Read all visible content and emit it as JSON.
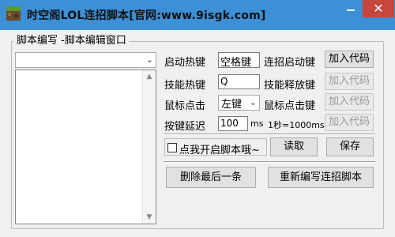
{
  "window": {
    "title": "时空阁LOL连招脚本[官网:www.9isgk.com]",
    "close_icon": "✕"
  },
  "group": {
    "label": "脚本编写 -脚本编辑窗口"
  },
  "combo": {
    "value": "",
    "arrow": "⌄"
  },
  "listbox": {
    "scroll_up": "▲",
    "scroll_down": "▼"
  },
  "row1": {
    "label": "启动热键",
    "hotkey": "空格键",
    "label2": "连招启动键",
    "button": "加入代码"
  },
  "row2": {
    "label": "技能热键",
    "value": "Q",
    "label2": "技能释放键",
    "button": "加入代码"
  },
  "row3": {
    "label": "鼠标点击",
    "select_value": "左键",
    "select_arrow": "⌄",
    "label2": "鼠标点击键",
    "button": "加入代码"
  },
  "row4": {
    "label": "按键延迟",
    "value": "100",
    "unit": "ms",
    "note": "1秒=1000ms",
    "button": "加入代码"
  },
  "options": {
    "checkbox_label": "点我开启脚本哦~",
    "read_button": "读取",
    "save_button": "保存"
  },
  "actions": {
    "delete_last": "删除最后一条",
    "rewrite": "重新编写连招脚本"
  },
  "colors": {
    "titlebar": "#3d8fd6",
    "close": "#c7463d"
  }
}
